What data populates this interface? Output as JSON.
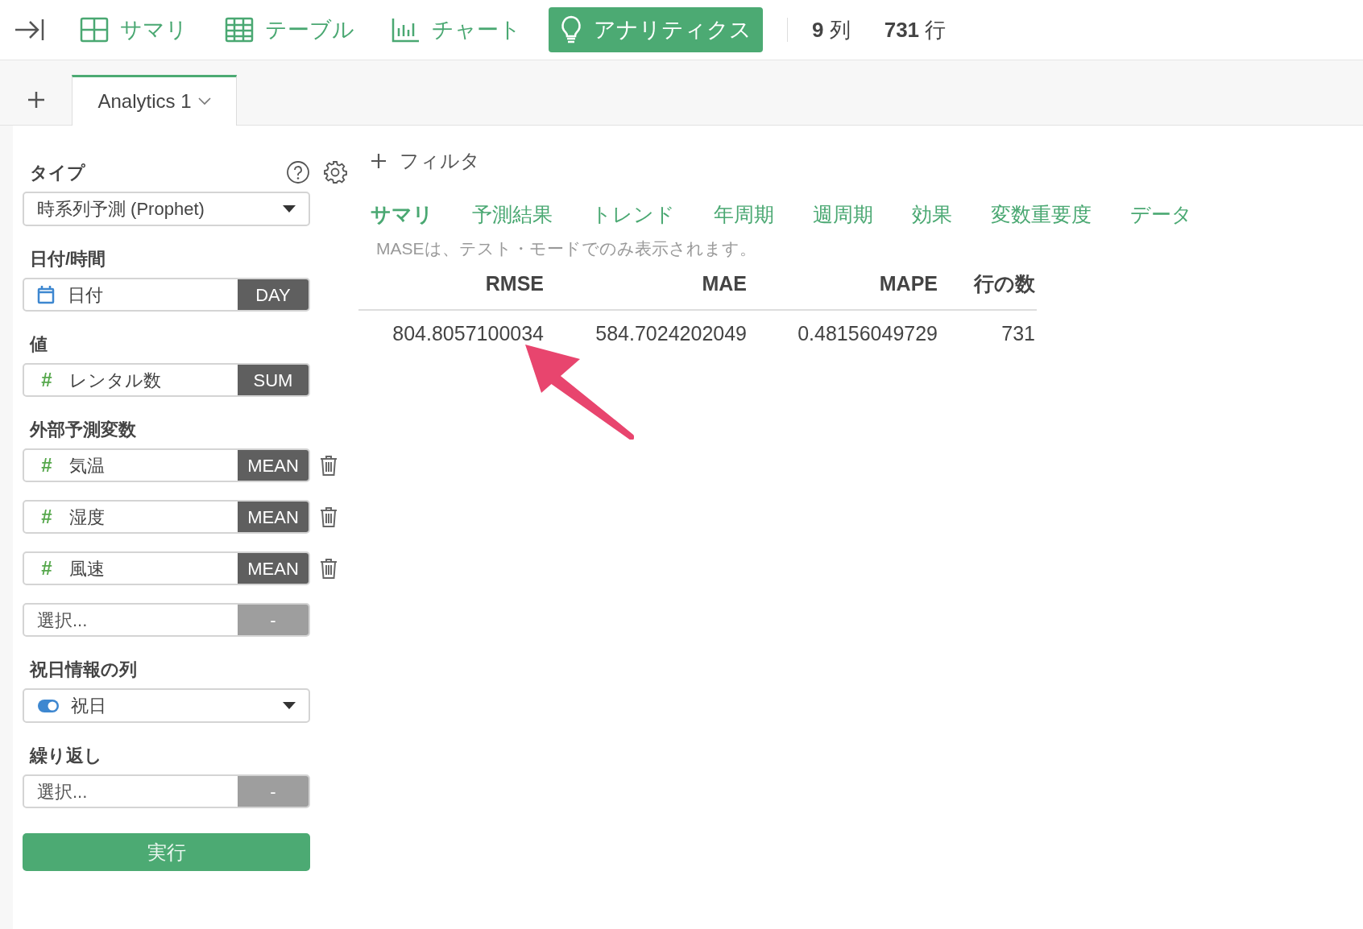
{
  "toolbar": {
    "views": [
      {
        "kind": "summary",
        "label": "サマリ",
        "selected": false
      },
      {
        "kind": "table",
        "label": "テーブル",
        "selected": false
      },
      {
        "kind": "chart",
        "label": "チャート",
        "selected": false
      },
      {
        "kind": "analytics",
        "label": "アナリティクス",
        "selected": true
      }
    ],
    "columns_count": "9",
    "columns_unit": "列",
    "rows_count": "731",
    "rows_unit": "行"
  },
  "tabs": [
    {
      "label": "Analytics 1",
      "selected": true
    }
  ],
  "sidebar": {
    "sections": [
      {
        "label": "タイプ",
        "kind": "select",
        "value": "時系列予測 (Prophet)",
        "help": true,
        "settings": true
      },
      {
        "label": "日付/時間",
        "kind": "fields",
        "fields": [
          {
            "kind": "date",
            "value": "日付",
            "agg": "DAY",
            "removable": false
          }
        ]
      },
      {
        "label": "値",
        "kind": "fields",
        "fields": [
          {
            "kind": "number",
            "type_mark": "#",
            "value": "レンタル数",
            "agg": "SUM",
            "removable": false
          }
        ]
      },
      {
        "label": "外部予測変数",
        "kind": "fields",
        "fields": [
          {
            "kind": "number",
            "type_mark": "#",
            "value": "気温",
            "agg": "MEAN",
            "removable": true
          },
          {
            "kind": "number",
            "type_mark": "#",
            "value": "湿度",
            "agg": "MEAN",
            "removable": true
          },
          {
            "kind": "number",
            "type_mark": "#",
            "value": "風速",
            "agg": "MEAN",
            "removable": true
          },
          {
            "kind": "empty",
            "placeholder": "選択...",
            "agg": "-",
            "removable": false
          }
        ]
      },
      {
        "label": "祝日情報の列",
        "kind": "toggle-select",
        "value": "祝日",
        "on": true
      },
      {
        "label": "繰り返し",
        "kind": "fields",
        "fields": [
          {
            "kind": "empty",
            "placeholder": "選択...",
            "agg": "-",
            "removable": false
          }
        ]
      }
    ],
    "run_button": "実行"
  },
  "main": {
    "filter": "フィルタ",
    "result_tabs": [
      {
        "label": "サマリ",
        "selected": true
      },
      {
        "label": "予測結果",
        "selected": false
      },
      {
        "label": "トレンド",
        "selected": false
      },
      {
        "label": "年周期",
        "selected": false
      },
      {
        "label": "週周期",
        "selected": false
      },
      {
        "label": "効果",
        "selected": false
      },
      {
        "label": "変数重要度",
        "selected": false
      },
      {
        "label": "データ",
        "selected": false
      }
    ],
    "note": "MASEは、テスト・モードでのみ表示されます。",
    "table": {
      "columns": [
        "RMSE",
        "MAE",
        "MAPE",
        "行の数"
      ],
      "rows": [
        [
          "804.8057100034",
          "584.7024202049",
          "0.48156049729",
          "731"
        ]
      ]
    }
  }
}
